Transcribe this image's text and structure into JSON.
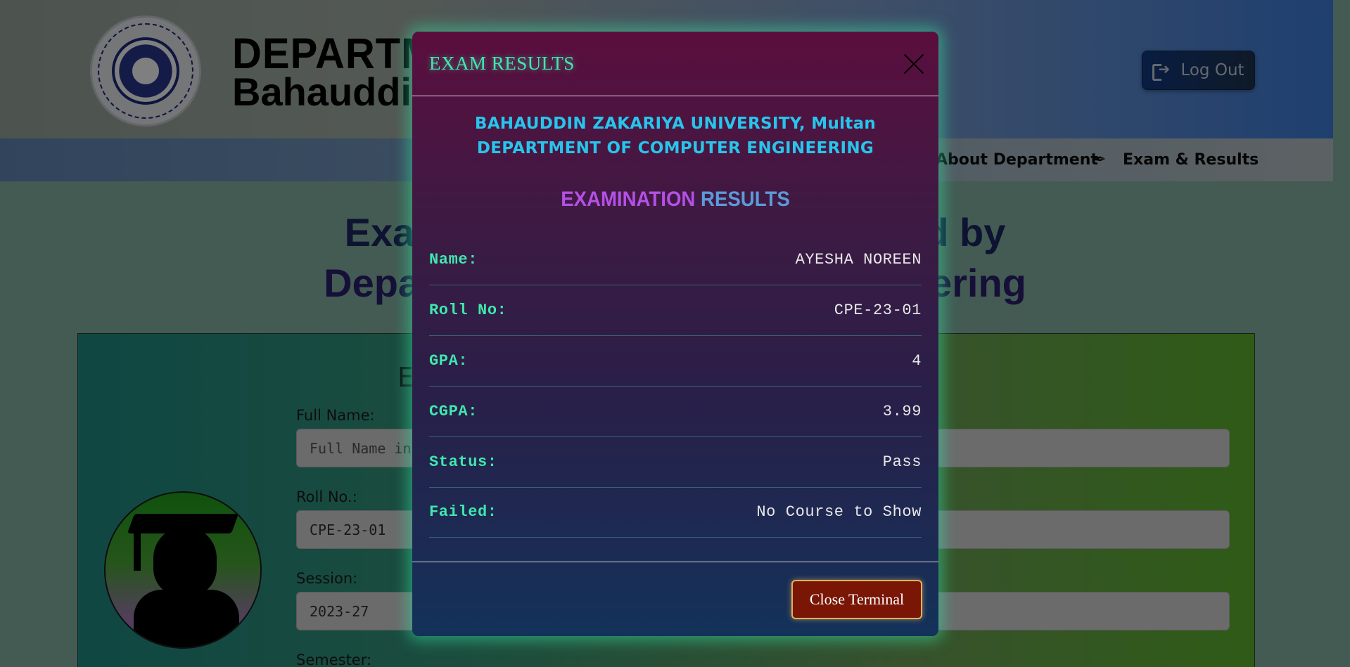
{
  "header": {
    "title_line1": "DEPARTMENT",
    "title_line2": "Bahauddin",
    "logout_label": "Log Out"
  },
  "nav": {
    "about": "About Department",
    "exam": "Exam & Results"
  },
  "main": {
    "heading_line1": "Examination Results Conducted by",
    "heading_line2": "Department of Computer Engineering"
  },
  "form": {
    "title": "Enter Your Details to Get Result",
    "fields": [
      {
        "label": "Full Name:",
        "value": "Full Name in Capital Letters",
        "placeholder": true
      },
      {
        "label": "Roll No.:",
        "value": "CPE-23-01",
        "placeholder": false
      },
      {
        "label": "Session:",
        "value": "2023-27",
        "placeholder": false
      },
      {
        "label": "Semester:",
        "value": "",
        "placeholder": false
      }
    ]
  },
  "modal": {
    "title": "EXAM RESULTS",
    "university": "BAHAUDDIN ZAKARIYA UNIVERSITY, Multan",
    "department": "DEPARTMENT OF COMPUTER ENGINEERING",
    "heading_word1": "EXAMINATION",
    "heading_word2": "RESULTS",
    "rows": [
      {
        "label": "Name:",
        "value": "AYESHA NOREEN"
      },
      {
        "label": "Roll No:",
        "value": "CPE-23-01"
      },
      {
        "label": "GPA:",
        "value": "4"
      },
      {
        "label": "CGPA:",
        "value": "3.99"
      },
      {
        "label": "Status:",
        "value": "Pass"
      },
      {
        "label": "Failed:",
        "value": "No Course to Show"
      }
    ],
    "close_button": "Close Terminal"
  },
  "colors": {
    "modal_accent": "#3fe8ad",
    "university_text": "#27c5ec",
    "close_button_bg": "#7a1606"
  }
}
